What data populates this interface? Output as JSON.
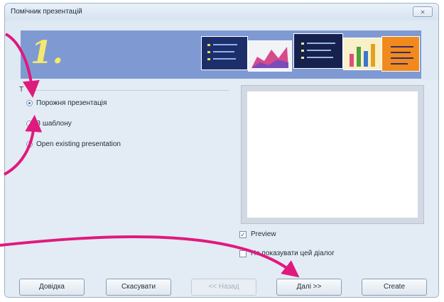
{
  "window": {
    "title": "Помічник презентацій",
    "close_label": "⨯"
  },
  "banner": {
    "step": "1."
  },
  "type_group": {
    "label": "Т",
    "options": [
      {
        "label": "Порожня презентація",
        "selected": true
      },
      {
        "label": "З шаблону",
        "selected": false
      },
      {
        "label": "Open existing presentation",
        "selected": false
      }
    ]
  },
  "preview": {
    "label": "Preview",
    "checked": true
  },
  "dont_show": {
    "label": "Не показувати цей діалог",
    "checked": false
  },
  "buttons": {
    "help": "Довідка",
    "cancel": "Скасувати",
    "back": "<< Назад",
    "next": "Далі >>",
    "create": "Create"
  },
  "colors": {
    "annotation_arrow": "#e0197d",
    "banner": "#7f9ad3"
  }
}
